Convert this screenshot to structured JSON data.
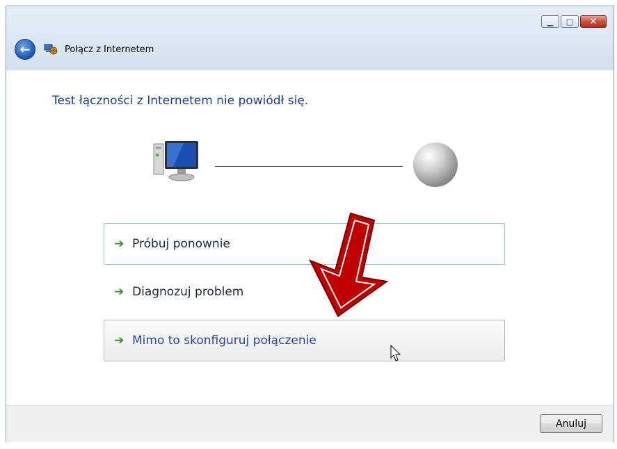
{
  "window": {
    "title": "Połącz z Internetem",
    "minimize_glyph": "▁",
    "maximize_glyph": "□",
    "close_glyph": "✕"
  },
  "nav": {
    "back_glyph": "←"
  },
  "content": {
    "heading": "Test łączności z Internetem nie powiódł się.",
    "options": [
      {
        "label": "Próbuj ponownie",
        "arrow": "➔"
      },
      {
        "label": "Diagnozuj problem",
        "arrow": "➔"
      },
      {
        "label": "Mimo to skonfiguruj połączenie",
        "arrow": "➔"
      }
    ]
  },
  "footer": {
    "cancel_label": "Anuluj"
  },
  "colors": {
    "heading": "#1d3f8f",
    "option_arrow": "#2b9a1a",
    "highlight_arrow": "#c00000",
    "retry_border": "#8fd0e0"
  },
  "icons": {
    "computer": "computer-icon",
    "globe": "globe-icon",
    "wizard": "network-wizard-icon",
    "back": "back-arrow-icon"
  }
}
